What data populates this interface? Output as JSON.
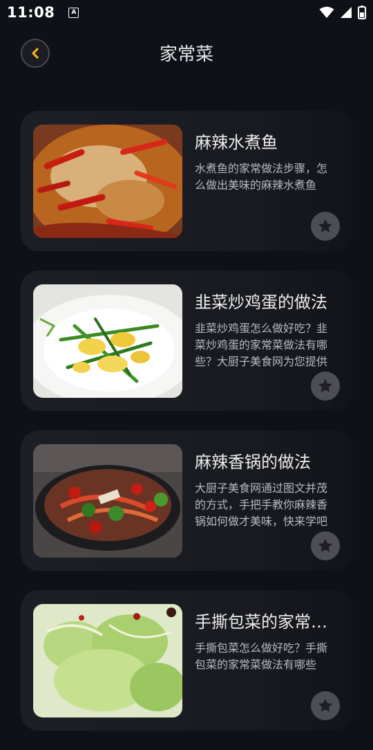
{
  "status_bar": {
    "time": "11:08",
    "app_icon_letter": "A",
    "icons": [
      "wifi-icon",
      "cellular-signal-icon",
      "battery-icon"
    ]
  },
  "header": {
    "title": "家常菜",
    "back_icon": "chevron-left-icon",
    "accent_color": "#f5b21a"
  },
  "recipes": [
    {
      "title": "麻辣水煮鱼",
      "description": "水煮鱼的家常做法步骤，怎么做出美味的麻辣水煮鱼",
      "favorite_icon": "star-icon"
    },
    {
      "title": "韭菜炒鸡蛋的做法",
      "description": "韭菜炒鸡蛋怎么做好吃？韭菜炒鸡蛋的家常菜做法有哪些？大厨子美食网为您提供",
      "favorite_icon": "star-icon"
    },
    {
      "title": "麻辣香锅的做法",
      "description": "大厨子美食网通过图文并茂的方式，手把手教你麻辣香锅如何做才美味，快来学吧",
      "favorite_icon": "star-icon"
    },
    {
      "title": "手撕包菜的家常做法",
      "description": "手撕包菜怎么做好吃？手撕包菜的家常菜做法有哪些",
      "favorite_icon": "star-icon"
    }
  ]
}
